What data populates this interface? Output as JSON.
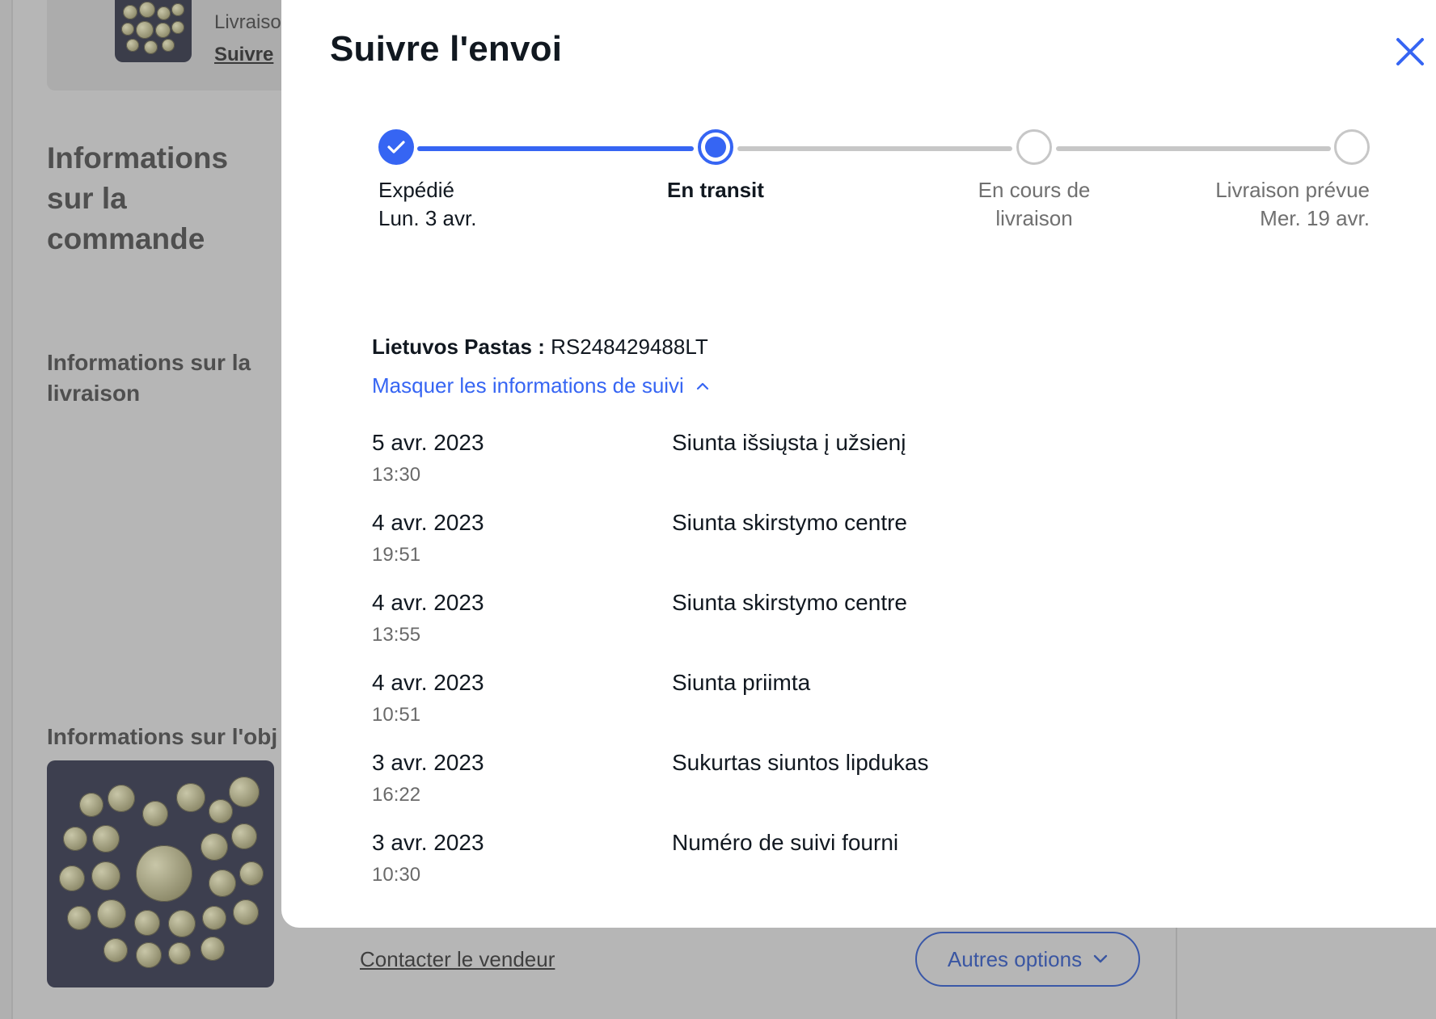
{
  "background": {
    "top_card": {
      "status_text": "Livraiso",
      "track_link": "Suivre"
    },
    "order_info_heading": "Informations sur la commande",
    "shipping_info_heading": "Informations sur la livraison",
    "item_info_heading": "Informations sur l'obj",
    "contact_seller": "Contacter le vendeur",
    "more_options": "Autres options"
  },
  "modal": {
    "title": "Suivre l'envoi",
    "steps": [
      {
        "label": "Expédié",
        "sub": "Lun. 3 avr.",
        "state": "done"
      },
      {
        "label": "En transit",
        "sub": "",
        "state": "current"
      },
      {
        "label": "En cours de",
        "sub": "livraison",
        "state": "todo"
      },
      {
        "label": "Livraison prévue",
        "sub": "Mer. 19 avr.",
        "state": "todo"
      }
    ],
    "carrier_name": "Lietuvos Pastas :",
    "tracking_number": "RS248429488LT",
    "toggle_details": "Masquer les informations de suivi",
    "events": [
      {
        "date": "5 avr. 2023",
        "time": "13:30",
        "desc": "Siunta išsiųsta į užsienį"
      },
      {
        "date": "4 avr. 2023",
        "time": "19:51",
        "desc": "Siunta skirstymo centre"
      },
      {
        "date": "4 avr. 2023",
        "time": "13:55",
        "desc": "Siunta skirstymo centre"
      },
      {
        "date": "4 avr. 2023",
        "time": "10:51",
        "desc": "Siunta priimta"
      },
      {
        "date": "3 avr. 2023",
        "time": "16:22",
        "desc": "Sukurtas siuntos lipdukas"
      },
      {
        "date": "3 avr. 2023",
        "time": "10:30",
        "desc": "Numéro de suivi fourni"
      }
    ]
  },
  "colors": {
    "accent": "#3665f3",
    "text": "#111820",
    "muted": "#707070",
    "track_inactive": "#c7c7c7"
  },
  "icons": {
    "close": "close-icon",
    "chevron_up": "chevron-up-icon",
    "chevron_down": "chevron-down-icon",
    "check": "check-icon"
  }
}
